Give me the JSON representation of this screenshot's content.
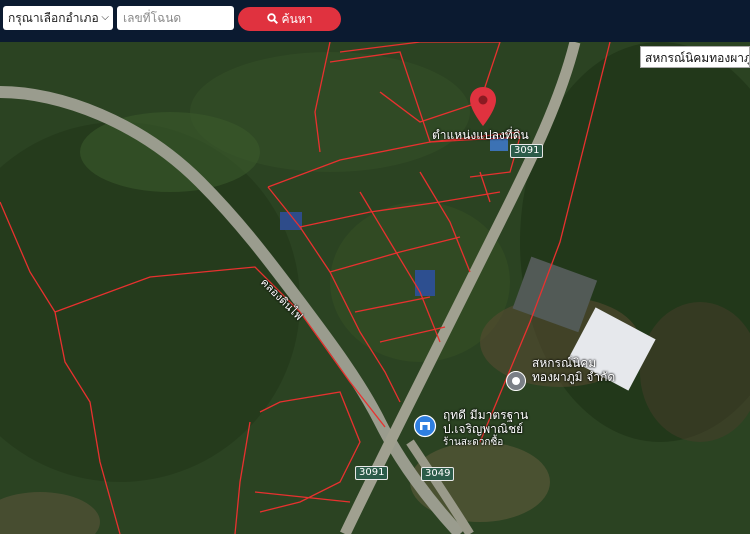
{
  "search": {
    "district_select": "กรุณาเลือกอำเภอ",
    "deed_placeholder": "เลขที่โฉนด",
    "search_button": "ค้นหา"
  },
  "map": {
    "marker_label": "ตำแหน่งแปลงที่ดิน",
    "road_label": "คลองดินไฟ",
    "routes": [
      "3091",
      "3091",
      "3049"
    ],
    "poi_coop_line1": "สหกรณ์นิคม",
    "poi_coop_line2": "ทองผาภูมิ จำกัด",
    "poi_shop_line1": "ฤทดี มีมาตรฐาน",
    "poi_shop_line2": "ป.เจริญพาณิชย์",
    "poi_shop_sub": "ร้านสะดวกซื้อ",
    "tooltip": "สหกรณ์นิคมทองผาภูมิ",
    "marker_color": "#e0323f",
    "parcel_line_color": "#e8312f"
  }
}
